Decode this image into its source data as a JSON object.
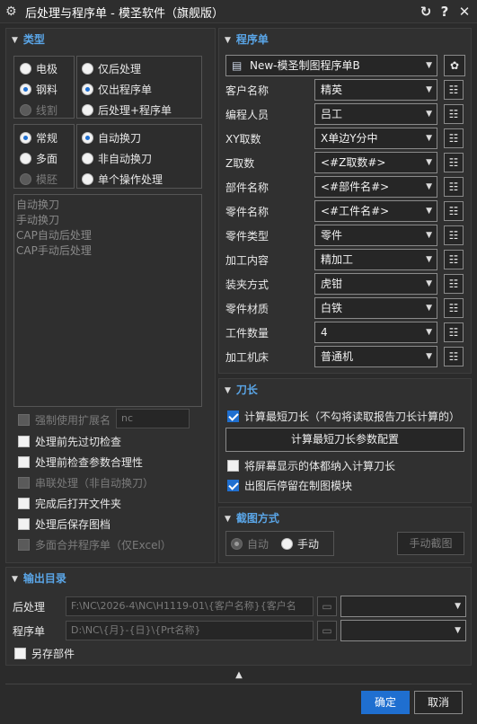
{
  "window": {
    "title": "后处理与程序单 - 模圣软件（旗舰版）",
    "icons": {
      "app": "gear-icon",
      "refresh": "refresh-icon",
      "help": "help-icon",
      "close": "close-icon"
    }
  },
  "type_section": {
    "title": "类型",
    "group1_left": [
      {
        "label": "电极",
        "checked": false,
        "enabled": true
      },
      {
        "label": "钢料",
        "checked": true,
        "enabled": true
      },
      {
        "label": "线割",
        "checked": false,
        "enabled": false
      }
    ],
    "group1_right": [
      {
        "label": "仅后处理",
        "checked": false,
        "enabled": true
      },
      {
        "label": "仅出程序单",
        "checked": true,
        "enabled": true
      },
      {
        "label": "后处理+程序单",
        "checked": false,
        "enabled": true
      }
    ],
    "group2_left": [
      {
        "label": "常规",
        "checked": true,
        "enabled": true
      },
      {
        "label": "多面",
        "checked": false,
        "enabled": true
      },
      {
        "label": "模胚",
        "checked": false,
        "enabled": false
      }
    ],
    "group2_right": [
      {
        "label": "自动换刀",
        "checked": true,
        "enabled": true
      },
      {
        "label": "非自动换刀",
        "checked": false,
        "enabled": true
      },
      {
        "label": "单个操作处理",
        "checked": false,
        "enabled": true
      }
    ],
    "list_items": [
      "自动换刀",
      "手动换刀",
      "CAP自动后处理",
      "CAP手动后处理"
    ],
    "checkboxes": [
      {
        "label": "强制使用扩展名",
        "checked": false,
        "enabled": false,
        "value": "nc"
      },
      {
        "label": "处理前先过切检查",
        "checked": false,
        "enabled": true
      },
      {
        "label": "处理前检查参数合理性",
        "checked": false,
        "enabled": true
      },
      {
        "label": "串联处理（非自动换刀）",
        "checked": false,
        "enabled": false
      },
      {
        "label": "完成后打开文件夹",
        "checked": false,
        "enabled": true
      },
      {
        "label": "处理后保存图档",
        "checked": false,
        "enabled": true
      },
      {
        "label": "多面合并程序单（仅Excel）",
        "checked": false,
        "enabled": false
      }
    ]
  },
  "program_section": {
    "title": "程序单",
    "template": "New-模圣制图程序单B",
    "template_icons": {
      "doc": "document-icon",
      "settings": "settings-icon"
    },
    "fields": [
      {
        "label": "客户名称",
        "value": "精英"
      },
      {
        "label": "编程人员",
        "value": "吕工"
      },
      {
        "label": "XY取数",
        "value": "X单边Y分中"
      },
      {
        "label": "Z取数",
        "value": "<#Z取数#>"
      },
      {
        "label": "部件名称",
        "value": "<#部件名#>"
      },
      {
        "label": "零件名称",
        "value": "<#工件名#>"
      },
      {
        "label": "零件类型",
        "value": "零件"
      },
      {
        "label": "加工内容",
        "value": "精加工"
      },
      {
        "label": "装夹方式",
        "value": "虎钳"
      },
      {
        "label": "零件材质",
        "value": "白铁"
      },
      {
        "label": "工件数量",
        "value": "4"
      },
      {
        "label": "加工机床",
        "value": "普通机"
      }
    ],
    "list_icon": "list-edit-icon"
  },
  "tool_section": {
    "title": "刀长",
    "calc_shortest": {
      "label": "计算最短刀长（不勾将读取报告刀长计算的）",
      "checked": true
    },
    "config_button": "计算最短刀长参数配置",
    "include_bodies": {
      "label": "将屏幕显示的体都纳入计算刀长",
      "checked": false
    },
    "stay_in_module": {
      "label": "出图后停留在制图模块",
      "checked": true
    }
  },
  "screenshot_section": {
    "title": "截图方式",
    "options": [
      {
        "label": "自动",
        "checked": true
      },
      {
        "label": "手动",
        "checked": false
      }
    ],
    "manual_button": "手动截图"
  },
  "output_section": {
    "title": "输出目录",
    "post_label": "后处理",
    "post_path": "F:\\NC\\2026-4\\NC\\H1119-01\\{客户名称}{客户名",
    "program_label": "程序单",
    "program_path": "D:\\NC\\{月}-{日}\\{Prt名称}",
    "save_part": {
      "label": "另存部件",
      "checked": false
    },
    "folder_icon": "folder-icon"
  },
  "footer": {
    "collapse_icon": "chevron-up-icon",
    "ok": "确定",
    "cancel": "取消"
  }
}
